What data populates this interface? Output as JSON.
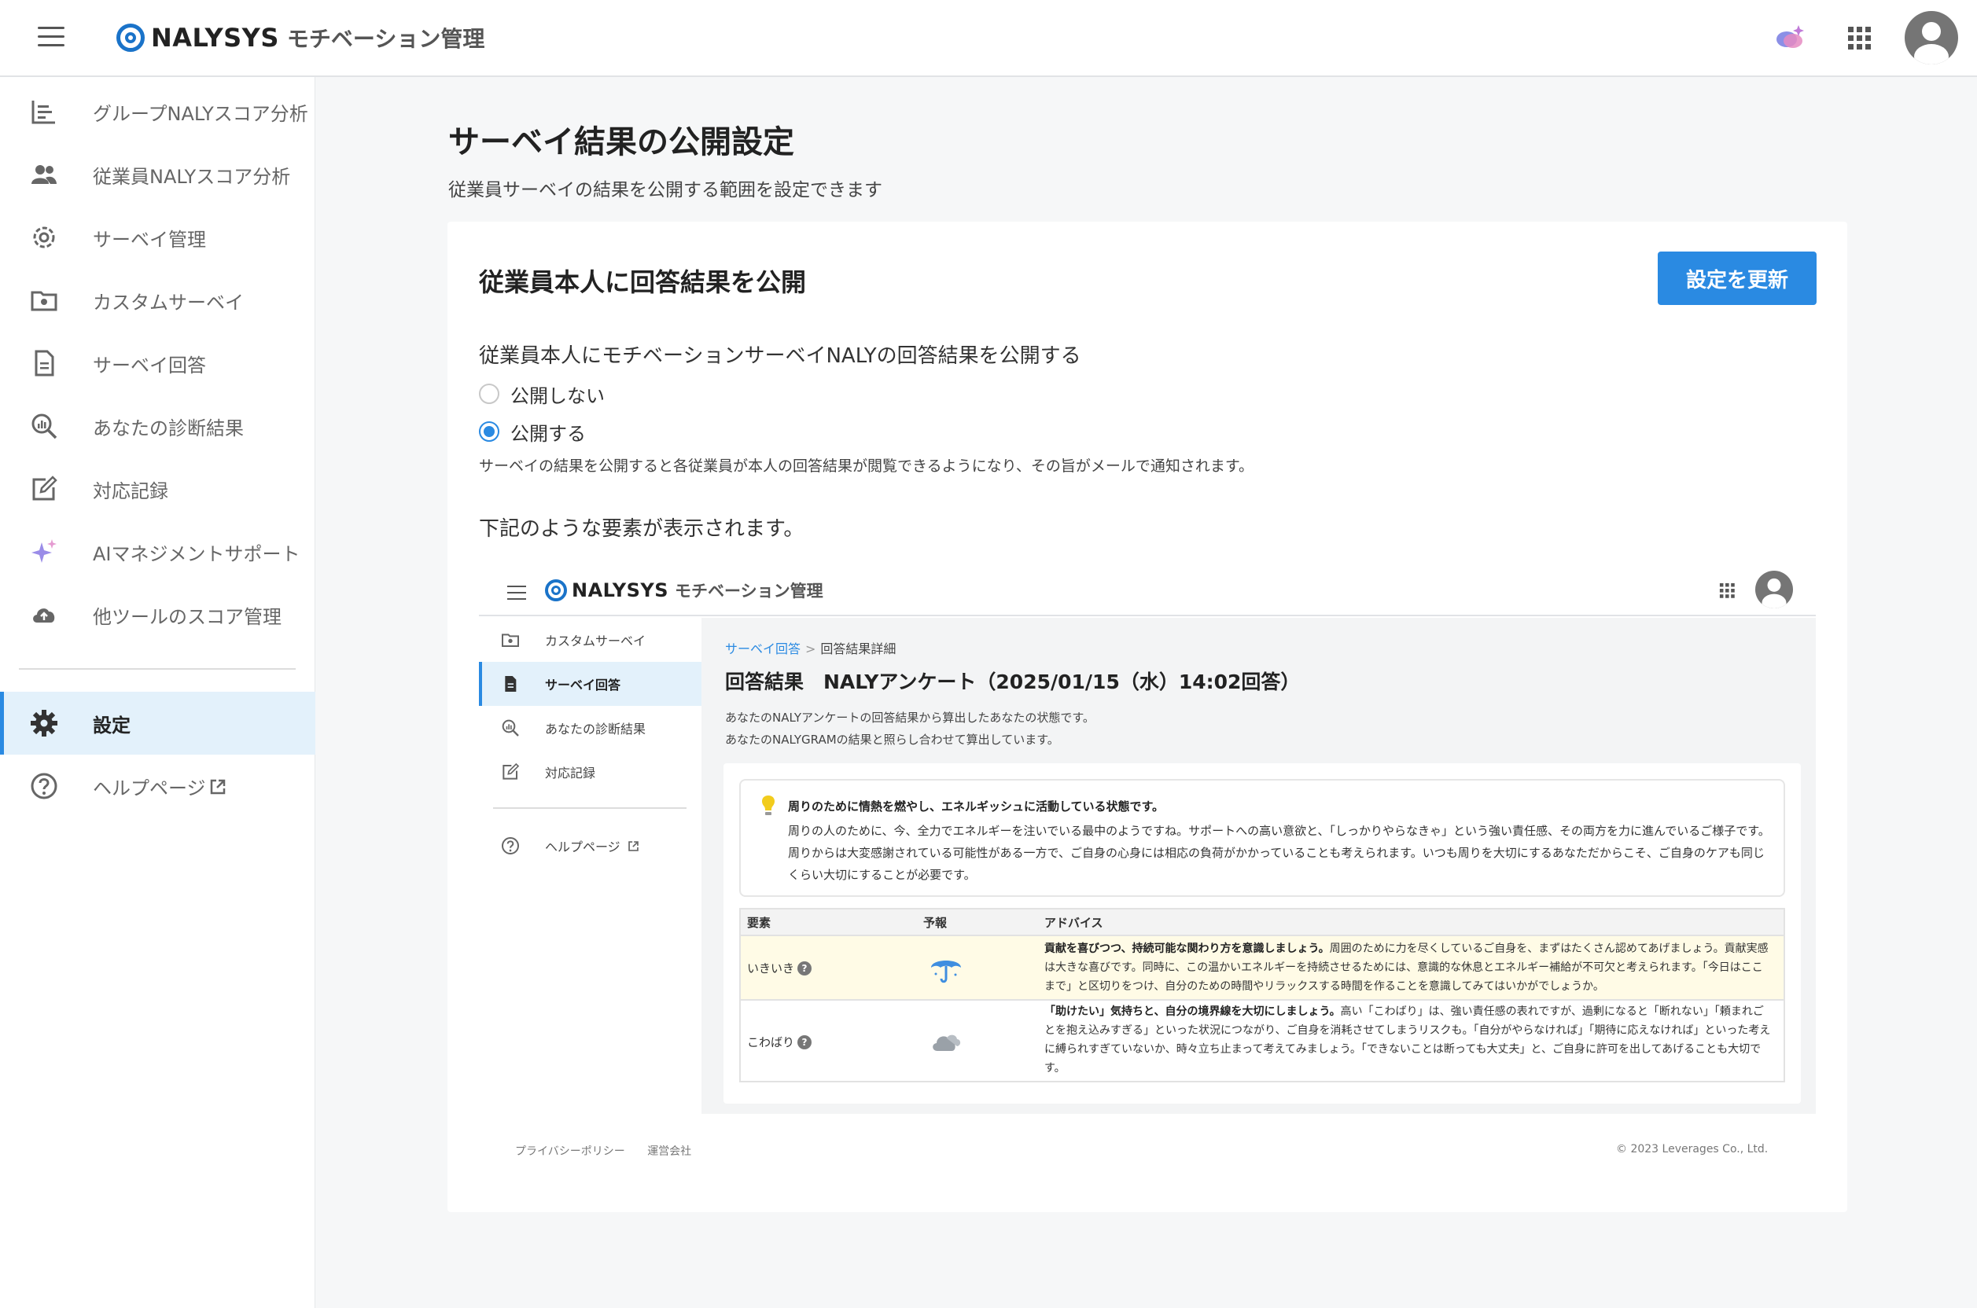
{
  "header": {
    "brand": "NALYSYS",
    "product": "モチベーション管理"
  },
  "sidebar": {
    "items": [
      {
        "label": "グループNALYスコア分析",
        "icon": "bar-chart-icon"
      },
      {
        "label": "従業員NALYスコア分析",
        "icon": "people-icon"
      },
      {
        "label": "サーベイ管理",
        "icon": "gear-outline-icon"
      },
      {
        "label": "カスタムサーベイ",
        "icon": "folder-gear-icon"
      },
      {
        "label": "サーベイ回答",
        "icon": "document-icon"
      },
      {
        "label": "あなたの診断結果",
        "icon": "magnifier-chart-icon"
      },
      {
        "label": "対応記録",
        "icon": "edit-note-icon"
      },
      {
        "label": "AIマネジメントサポート",
        "icon": "sparkle-icon"
      },
      {
        "label": "他ツールのスコア管理",
        "icon": "cloud-upload-icon"
      }
    ],
    "settings_label": "設定",
    "help_label": "ヘルプページ"
  },
  "main": {
    "title": "サーベイ結果の公開設定",
    "description": "従業員サーベイの結果を公開する範囲を設定できます",
    "card": {
      "title": "従業員本人に回答結果を公開",
      "update_button": "設定を更新",
      "question": "従業員本人にモチベーションサーベイNALYの回答結果を公開する",
      "options": [
        {
          "label": "公開しない",
          "checked": false
        },
        {
          "label": "公開する",
          "checked": true
        }
      ],
      "note": "サーベイの結果を公開すると各従業員が本人の回答結果が閲覧できるようになり、その旨がメールで通知されます。",
      "preview_heading": "下記のような要素が表示されます。"
    }
  },
  "preview": {
    "brand": "NALYSYS",
    "product": "モチベーション管理",
    "nav": [
      {
        "label": "カスタムサーベイ",
        "icon": "folder-gear-icon"
      },
      {
        "label": "サーベイ回答",
        "icon": "document-icon",
        "active": true
      },
      {
        "label": "あなたの診断結果",
        "icon": "magnifier-chart-icon"
      },
      {
        "label": "対応記録",
        "icon": "edit-note-icon"
      }
    ],
    "help_label": "ヘルプページ",
    "breadcrumb": {
      "link": "サーベイ回答",
      "sep": ">",
      "current": "回答結果詳細"
    },
    "title": "回答結果　NALYアンケート（2025/01/15（水）14:02回答）",
    "desc1": "あなたのNALYアンケートの回答結果から算出したあなたの状態です。",
    "desc2": "あなたのNALYGRAMの結果と照らし合わせて算出しています。",
    "insight_head": "周りのために情熱を燃やし、エネルギッシュに活動している状態です。",
    "insight_body": "周りの人のために、今、全力でエネルギーを注いでいる最中のようですね。サポートへの高い意欲と、「しっかりやらなきゃ」という強い責任感、その両方を力に進んでいるご様子です。周りからは大変感謝されている可能性がある一方で、ご自身の心身には相応の負荷がかかっていることも考えられます。いつも周りを大切にするあなただからこそ、ご自身のケアも同じくらい大切にすることが必要です。",
    "table_headers": [
      "要素",
      "予報",
      "アドバイス"
    ],
    "rows": [
      {
        "element": "いきいき",
        "forecast_icon": "umbrella-icon",
        "advice_bold": "貢献を喜びつつ、持続可能な関わり方を意識しましょう。",
        "advice": "周囲のために力を尽くしているご自身を、まずはたくさん認めてあげましょう。貢献実感は大きな喜びです。同時に、この温かいエネルギーを持続させるためには、意識的な休息とエネルギー補給が不可欠と考えられます。「今日はここまで」と区切りをつけ、自分のための時間やリラックスする時間を作ることを意識してみてはいかがでしょうか。"
      },
      {
        "element": "こわばり",
        "forecast_icon": "cloud-icon",
        "advice_bold": "「助けたい」気持ちと、自分の境界線を大切にしましょう。",
        "advice": "高い「こわばり」は、強い責任感の表れですが、過剰になると「断れない」「頼まれごとを抱え込みすぎる」といった状況につながり、ご自身を消耗させてしまうリスクも。「自分がやらなければ」「期待に応えなければ」といった考えに縛られすぎていないか、時々立ち止まって考えてみましょう。「できないことは断っても大丈夫」と、ご自身に許可を出してあげることも大切です。"
      }
    ],
    "footer_links": [
      "プライバシーポリシー",
      "運営会社"
    ],
    "copyright": "© 2023 Leverages Co., Ltd."
  },
  "colors": {
    "accent": "#2a8ae2",
    "brand": "#1a73c9",
    "highlight_row": "#fffbe6"
  }
}
